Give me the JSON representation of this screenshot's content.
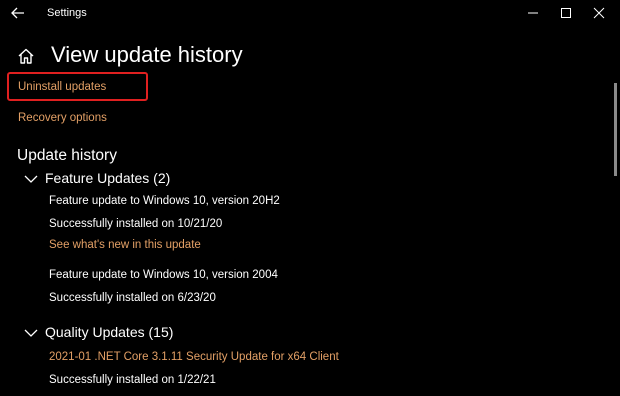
{
  "window": {
    "app_title": "Settings",
    "controls": {
      "minimize": "minimize-icon",
      "maximize": "maximize-icon",
      "close": "close-icon"
    },
    "back_icon": "back-arrow-icon"
  },
  "header": {
    "home_icon": "home-icon",
    "title": "View update history"
  },
  "links": {
    "uninstall": "Uninstall updates",
    "recovery": "Recovery options"
  },
  "history": {
    "title": "Update history",
    "feature_updates": {
      "label": "Feature Updates (2)",
      "items": [
        {
          "name": "Feature update to Windows 10, version 20H2",
          "status": "Successfully installed on 10/21/20",
          "link": "See what's new in this update"
        },
        {
          "name": "Feature update to Windows 10, version 2004",
          "status": "Successfully installed on 6/23/20"
        }
      ]
    },
    "quality_updates": {
      "label": "Quality Updates (15)",
      "items": [
        {
          "name": "2021-01 .NET Core 3.1.11 Security Update for x64 Client",
          "status": "Successfully installed on 1/22/21"
        }
      ]
    }
  },
  "colors": {
    "background": "#000000",
    "text": "#ffffff",
    "accent_link": "#e3a066",
    "highlight": "#e02020",
    "scrollbar": "#8a8a8a"
  }
}
